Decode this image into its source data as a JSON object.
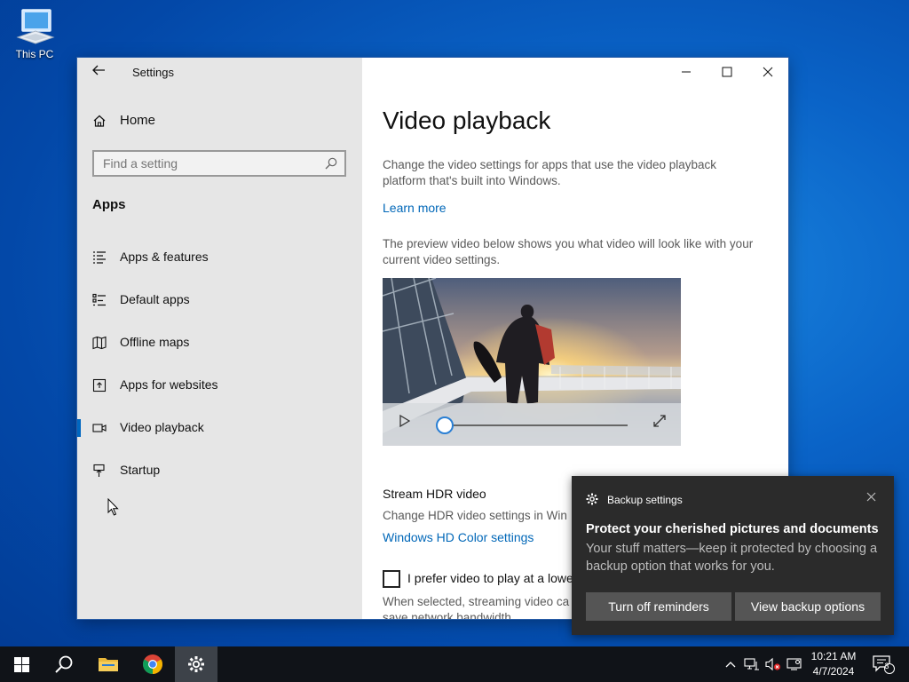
{
  "desktop": {
    "icon_label": "This PC"
  },
  "window": {
    "title": "Settings",
    "controls": {
      "minimize": "—",
      "maximize": "☐",
      "close": "✕"
    }
  },
  "sidebar": {
    "home_label": "Home",
    "search_placeholder": "Find a setting",
    "section": "Apps",
    "items": [
      {
        "label": "Apps & features",
        "icon": "apps-features-icon"
      },
      {
        "label": "Default apps",
        "icon": "default-apps-icon"
      },
      {
        "label": "Offline maps",
        "icon": "offline-maps-icon"
      },
      {
        "label": "Apps for websites",
        "icon": "apps-for-websites-icon"
      },
      {
        "label": "Video playback",
        "icon": "video-playback-icon",
        "active": true
      },
      {
        "label": "Startup",
        "icon": "startup-icon"
      }
    ]
  },
  "main": {
    "title": "Video playback",
    "desc1": "Change the video settings for apps that use the video playback platform that's built into Windows.",
    "learn_more": "Learn more",
    "desc2": "The preview video below shows you what video will look like with your current video settings.",
    "hdr_title": "Stream HDR video",
    "hdr_desc": "Change HDR video settings in Win",
    "hdr_link": "Windows HD Color settings",
    "checkbox_label": "I prefer video to play at a lowe",
    "checkbox_desc": "When selected, streaming video ca",
    "checkbox_desc2": "save network bandwidth"
  },
  "toast": {
    "app": "Backup settings",
    "headline": "Protect your cherished pictures and documents",
    "body": "Your stuff matters—keep it protected by choosing a backup option that works for you.",
    "btn1": "Turn off reminders",
    "btn2": "View backup options"
  },
  "taskbar": {
    "time": "10:21 AM",
    "date": "4/7/2024",
    "notifications": "3"
  },
  "colors": {
    "accent": "#0067c0",
    "link": "#0067b8",
    "sidebar_bg": "#e6e6e6",
    "toast_bg": "#2b2b2b",
    "taskbar_bg": "#101318"
  }
}
